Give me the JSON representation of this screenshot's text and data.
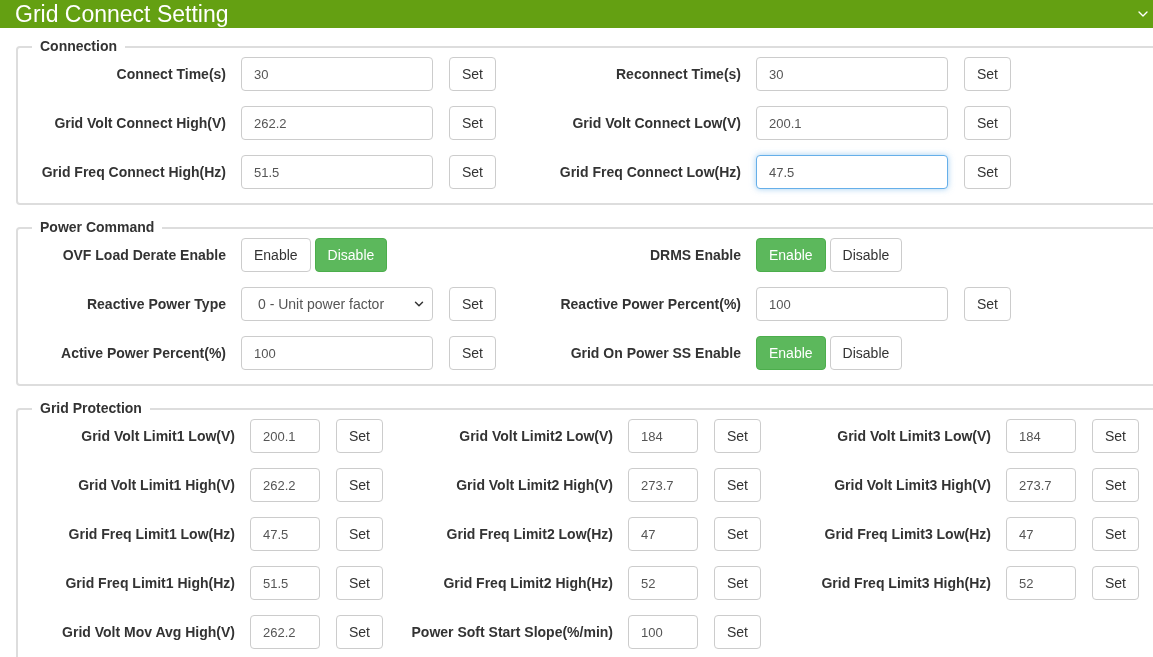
{
  "header": {
    "title": "Grid Connect Setting"
  },
  "sections": [
    {
      "title": "Connection",
      "kind": "wide",
      "items": [
        {
          "kind": "input",
          "label": "Connect Time(s)",
          "value": "30",
          "button": "Set",
          "focused": false
        },
        {
          "kind": "input",
          "label": "Reconnect Time(s)",
          "value": "30",
          "button": "Set",
          "focused": false
        },
        {
          "kind": "input",
          "label": "Grid Volt Connect High(V)",
          "value": "262.2",
          "button": "Set",
          "focused": false
        },
        {
          "kind": "input",
          "label": "Grid Volt Connect Low(V)",
          "value": "200.1",
          "button": "Set",
          "focused": false
        },
        {
          "kind": "input",
          "label": "Grid Freq Connect High(Hz)",
          "value": "51.5",
          "button": "Set",
          "focused": false
        },
        {
          "kind": "input",
          "label": "Grid Freq Connect Low(Hz)",
          "value": "47.5",
          "button": "Set",
          "focused": true
        }
      ]
    },
    {
      "title": "Power Command",
      "kind": "wide",
      "items": [
        {
          "kind": "toggle",
          "label": "OVF Load Derate Enable",
          "options": [
            {
              "label": "Enable",
              "selected": false
            },
            {
              "label": "Disable",
              "selected": true
            }
          ]
        },
        {
          "kind": "toggle",
          "label": "DRMS Enable",
          "options": [
            {
              "label": "Enable",
              "selected": true
            },
            {
              "label": "Disable",
              "selected": false
            }
          ]
        },
        {
          "kind": "select",
          "label": "Reactive Power Type",
          "value": "0 - Unit power factor",
          "button": "Set"
        },
        {
          "kind": "input",
          "label": "Reactive Power Percent(%)",
          "value": "100",
          "button": "Set",
          "focused": false
        },
        {
          "kind": "input",
          "label": "Active Power Percent(%)",
          "value": "100",
          "button": "Set",
          "focused": false
        },
        {
          "kind": "toggle",
          "label": "Grid On Power SS Enable",
          "options": [
            {
              "label": "Enable",
              "selected": true
            },
            {
              "label": "Disable",
              "selected": false
            }
          ]
        }
      ]
    },
    {
      "title": "Grid Protection",
      "kind": "narrow",
      "items": [
        {
          "kind": "input",
          "label": "Grid Volt Limit1 Low(V)",
          "value": "200.1",
          "button": "Set",
          "focused": false
        },
        {
          "kind": "input",
          "label": "Grid Volt Limit2 Low(V)",
          "value": "184",
          "button": "Set",
          "focused": false
        },
        {
          "kind": "input",
          "label": "Grid Volt Limit3 Low(V)",
          "value": "184",
          "button": "Set",
          "focused": false
        },
        {
          "kind": "input",
          "label": "Grid Volt Limit1 High(V)",
          "value": "262.2",
          "button": "Set",
          "focused": false
        },
        {
          "kind": "input",
          "label": "Grid Volt Limit2 High(V)",
          "value": "273.7",
          "button": "Set",
          "focused": false
        },
        {
          "kind": "input",
          "label": "Grid Volt Limit3 High(V)",
          "value": "273.7",
          "button": "Set",
          "focused": false
        },
        {
          "kind": "input",
          "label": "Grid Freq Limit1 Low(Hz)",
          "value": "47.5",
          "button": "Set",
          "focused": false
        },
        {
          "kind": "input",
          "label": "Grid Freq Limit2 Low(Hz)",
          "value": "47",
          "button": "Set",
          "focused": false
        },
        {
          "kind": "input",
          "label": "Grid Freq Limit3 Low(Hz)",
          "value": "47",
          "button": "Set",
          "focused": false
        },
        {
          "kind": "input",
          "label": "Grid Freq Limit1 High(Hz)",
          "value": "51.5",
          "button": "Set",
          "focused": false
        },
        {
          "kind": "input",
          "label": "Grid Freq Limit2 High(Hz)",
          "value": "52",
          "button": "Set",
          "focused": false
        },
        {
          "kind": "input",
          "label": "Grid Freq Limit3 High(Hz)",
          "value": "52",
          "button": "Set",
          "focused": false
        },
        {
          "kind": "input",
          "label": "Grid Volt Mov Avg High(V)",
          "value": "262.2",
          "button": "Set",
          "focused": false
        },
        {
          "kind": "input",
          "label": "Power Soft Start Slope(%/min)",
          "value": "100",
          "button": "Set",
          "focused": false
        }
      ]
    }
  ]
}
